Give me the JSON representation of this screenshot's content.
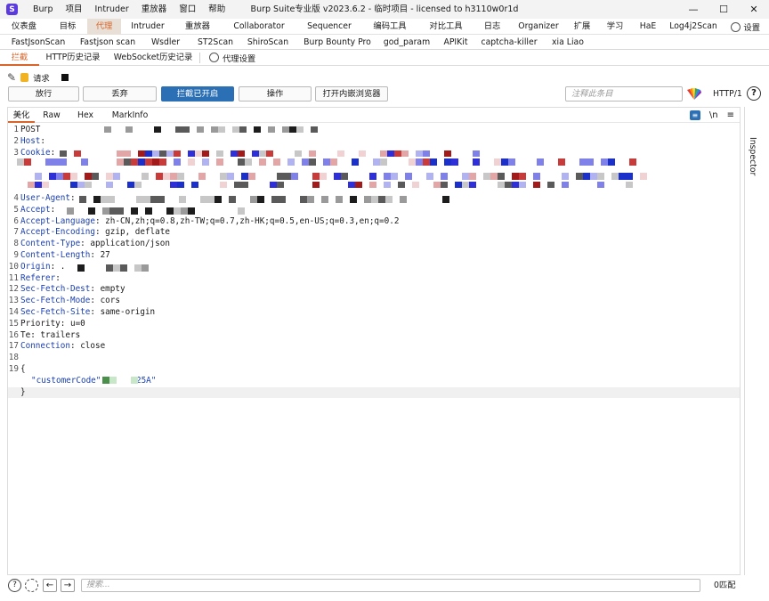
{
  "window": {
    "title": "Burp Suite专业版 v2023.6.2 - 临时项目 - licensed to h3110w0r1d",
    "menu": [
      "Burp",
      "项目",
      "Intruder",
      "重放器",
      "窗口",
      "帮助"
    ],
    "controls": [
      "—",
      "☐",
      "✕"
    ]
  },
  "main_tabs": [
    "仪表盘",
    "目标",
    "代理",
    "Intruder",
    "重放器",
    "Collaborator",
    "Sequencer",
    "编码工具",
    "对比工具",
    "日志",
    "Organizer",
    "扩展",
    "学习",
    "HaE",
    "Log4j2Scan"
  ],
  "settings_label": "设置",
  "ext_tabs": [
    "FastJsonScan",
    "Fastjson scan",
    "Wsdler",
    "ST2Scan",
    "ShiroScan",
    "Burp Bounty Pro",
    "god_param",
    "APIKit",
    "captcha-killer",
    "xia Liao"
  ],
  "proxy_tabs": [
    "拦截",
    "HTTP历史记录",
    "WebSocket历史记录"
  ],
  "proxy_settings_label": "代理设置",
  "request_label": "请求",
  "toolbar": {
    "forward": "放行",
    "drop": "丢弃",
    "intercept": "拦截已开启",
    "action": "操作",
    "browser": "打开内嵌浏览器",
    "comment_placeholder": "注释此条目",
    "protocol": "HTTP/1",
    "help": "?"
  },
  "editor_tabs": [
    "美化",
    "Raw",
    "Hex",
    "MarkInfo"
  ],
  "editor_icons": {
    "wrap": "wrap-icon",
    "newline": "\\n",
    "menu": "≡"
  },
  "inspector_label": "Inspector",
  "request_lines": [
    {
      "n": "1",
      "name": "POST",
      "sep": " ",
      "value": ""
    },
    {
      "n": "2",
      "name": "Host",
      "sep": ":",
      "value": ""
    },
    {
      "n": "3",
      "name": "Cookie",
      "sep": ":",
      "value": ""
    },
    {
      "n": "4",
      "name": "User-Agent",
      "sep": ":",
      "value": ""
    },
    {
      "n": "5",
      "name": "Accept",
      "sep": ":",
      "value": ""
    },
    {
      "n": "6",
      "name": "Accept-Language",
      "sep": ":",
      "value": " zh-CN,zh;q=0.8,zh-TW;q=0.7,zh-HK;q=0.5,en-US;q=0.3,en;q=0.2"
    },
    {
      "n": "7",
      "name": "Accept-Encoding",
      "sep": ":",
      "value": " gzip, deflate"
    },
    {
      "n": "8",
      "name": "Content-Type",
      "sep": ":",
      "value": " application/json"
    },
    {
      "n": "9",
      "name": "Content-Length",
      "sep": ":",
      "value": " 27"
    },
    {
      "n": "10",
      "name": "Origin",
      "sep": ":",
      "value": " ."
    },
    {
      "n": "11",
      "name": "Referer",
      "sep": ":",
      "value": ""
    },
    {
      "n": "12",
      "name": "Sec-Fetch-Dest",
      "sep": ":",
      "value": " empty"
    },
    {
      "n": "13",
      "name": "Sec-Fetch-Mode",
      "sep": ":",
      "value": " cors"
    },
    {
      "n": "14",
      "name": "Sec-Fetch-Site",
      "sep": ":",
      "value": " same-origin"
    },
    {
      "n": "15",
      "name": "Priority",
      "sep": ":",
      "value": " u=0"
    },
    {
      "n": "16",
      "name": "Te",
      "sep": ":",
      "value": " trailers"
    },
    {
      "n": "17",
      "name": "Connection",
      "sep": ":",
      "value": " close"
    }
  ],
  "json_body": {
    "line18": "18",
    "line19": "19",
    "open": "{",
    "key": "\"customerCode\"",
    "colon": ":",
    "value_tail": "25A\"",
    "close": "}"
  },
  "bottom": {
    "search_placeholder": "搜索...",
    "matches": "0匹配"
  },
  "colors": {
    "accent": "#d9652b",
    "primary_button": "#2b6fb4",
    "header_name": "#1a3fb0"
  }
}
